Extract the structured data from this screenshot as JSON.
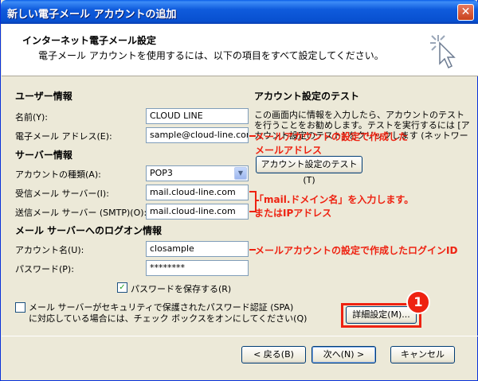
{
  "window": {
    "title": "新しい電子メール アカウントの追加",
    "close_glyph": "✕"
  },
  "header": {
    "title": "インターネット電子メール設定",
    "description": "電子メール アカウントを使用するには、以下の項目をすべて設定してください。"
  },
  "user_info": {
    "section": "ユーザー情報",
    "name_label": "名前(Y):",
    "name_value": "CLOUD LINE",
    "email_label": "電子メール アドレス(E):",
    "email_value": "sample@cloud-line.com"
  },
  "server_info": {
    "section": "サーバー情報",
    "account_type_label": "アカウントの種類(A):",
    "account_type_value": "POP3",
    "incoming_label": "受信メール サーバー(I):",
    "incoming_value": "mail.cloud-line.com",
    "outgoing_label": "送信メール サーバー (SMTP)(O):",
    "outgoing_value": "mail.cloud-line.com"
  },
  "logon_info": {
    "section": "メール サーバーへのログオン情報",
    "account_name_label": "アカウント名(U):",
    "account_name_value": "closample",
    "password_label": "パスワード(P):",
    "password_value": "********",
    "save_password_label": "パスワードを保存する(R)",
    "save_password_checked": "✓"
  },
  "test": {
    "section": "アカウント設定のテスト",
    "description": "この画面内に情報を入力したら、アカウントのテストを行うことをお勧めします。テストを実行するには [アカウント設定のテスト] をクリックします (ネットワークに接続されている必要があります)。",
    "button": "アカウント設定のテスト(T)"
  },
  "spa": {
    "label_line1": "メール サーバーがセキュリティで保護されたパスワード認証 (SPA)",
    "label_line2": "に対応している場合には、チェック ボックスをオンにしてください(Q)"
  },
  "buttons": {
    "advanced": "詳細設定(M)...",
    "back": "< 戻る(B)",
    "next": "次へ(N) >",
    "cancel": "キャンセル"
  },
  "annotations": {
    "email_line1": "メールアカウントの設定で作成した",
    "email_line2": "メールアドレス",
    "server_line1": "「mail.ドメイン名」を入力します。",
    "server_line2": "またはIPアドレス",
    "account_name": "メールアカウントの設定で作成したログインID",
    "badge": "1"
  },
  "colors": {
    "annotation": "#ee2211",
    "titlebar": "#0850d0",
    "dialog_bg": "#ece9d8"
  }
}
